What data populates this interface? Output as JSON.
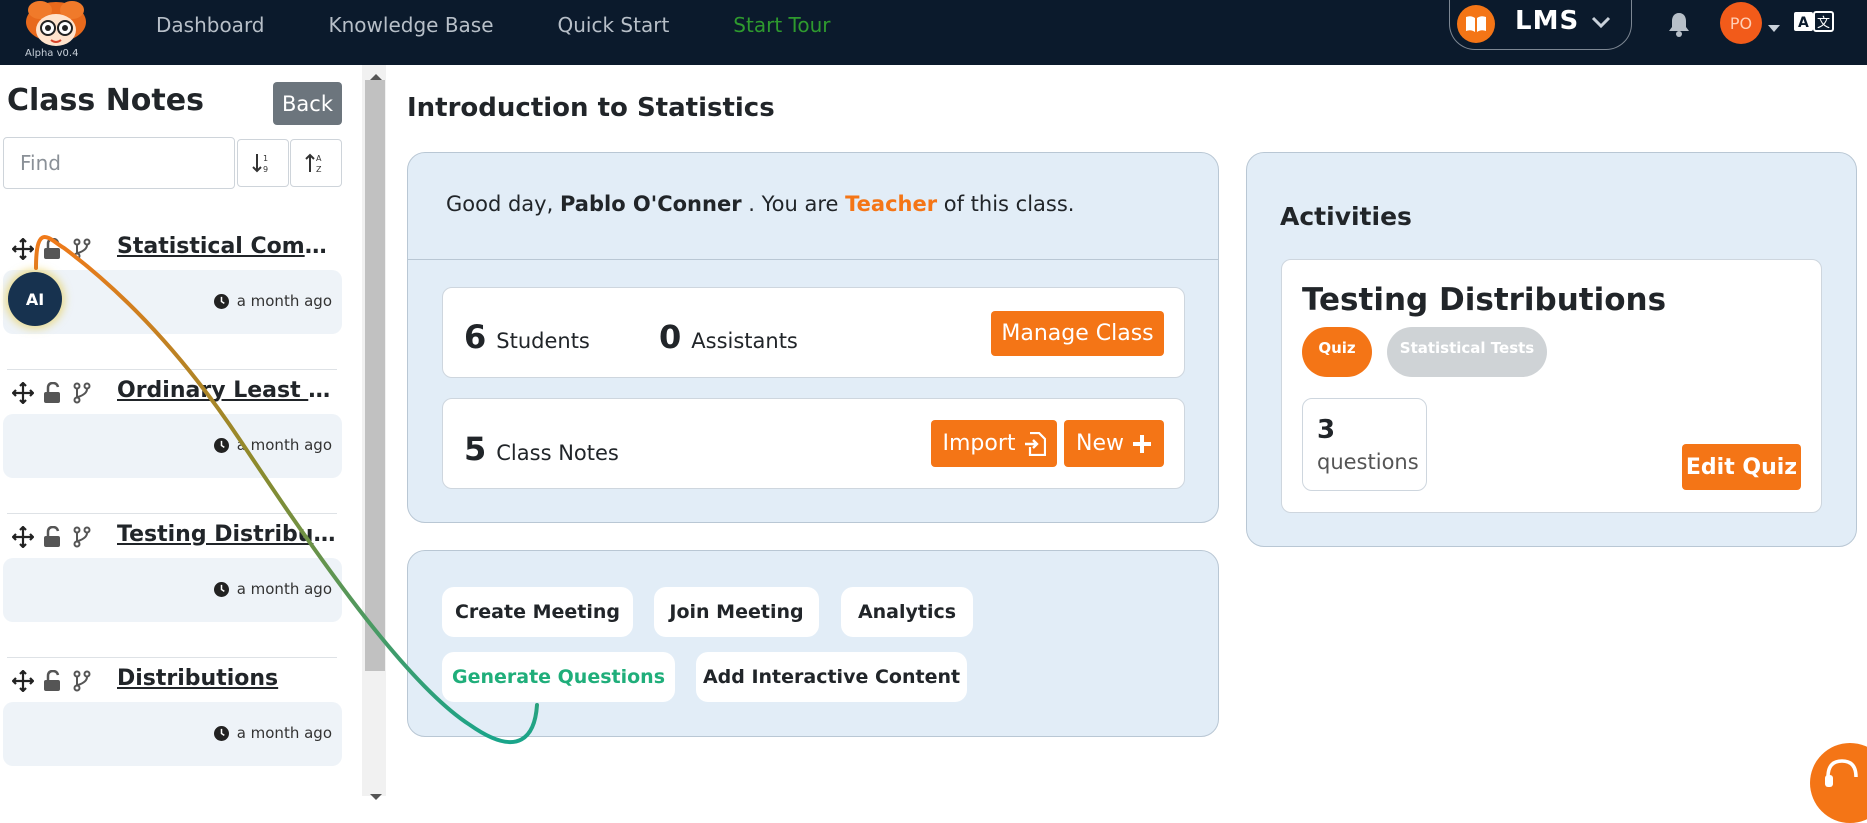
{
  "app": {
    "version": "Alpha v0.4",
    "brand_color": "#f47516",
    "nav_bg": "#0b1a2c"
  },
  "nav": {
    "links": [
      "Dashboard",
      "Knowledge Base",
      "Quick Start",
      "Start Tour"
    ],
    "product": "LMS",
    "avatar_initials": "PO"
  },
  "sidebar": {
    "title": "Class Notes",
    "back_label": "Back",
    "find_placeholder": "Find",
    "ai_badge": "AI",
    "notes": [
      {
        "title": "Statistical Comparisons",
        "time": "a month ago"
      },
      {
        "title": "Ordinary Least Squares",
        "time": "a month ago"
      },
      {
        "title": "Testing Distributions",
        "time": "a month ago"
      },
      {
        "title": "Distributions",
        "time": "a month ago"
      }
    ]
  },
  "main": {
    "title": "Introduction to Statistics",
    "greeting": {
      "prefix": "Good day,",
      "name": "Pablo O'Conner",
      "middle": ". You are",
      "role": "Teacher",
      "suffix": "of this class."
    },
    "students": {
      "count": "6",
      "label": "Students"
    },
    "assistants": {
      "count": "0",
      "label": "Assistants"
    },
    "manage_label": "Manage Class",
    "class_notes": {
      "count": "5",
      "label": "Class Notes"
    },
    "import_label": "Import",
    "new_label": "New",
    "actions": [
      "Create Meeting",
      "Join Meeting",
      "Analytics",
      "Generate Questions",
      "Add Interactive Content"
    ]
  },
  "activities": {
    "title": "Activities",
    "item": {
      "name": "Testing Distributions",
      "tags": [
        "Quiz",
        "Statistical Tests"
      ],
      "questions_count": "3",
      "questions_label": "questions",
      "edit_label": "Edit Quiz"
    }
  }
}
